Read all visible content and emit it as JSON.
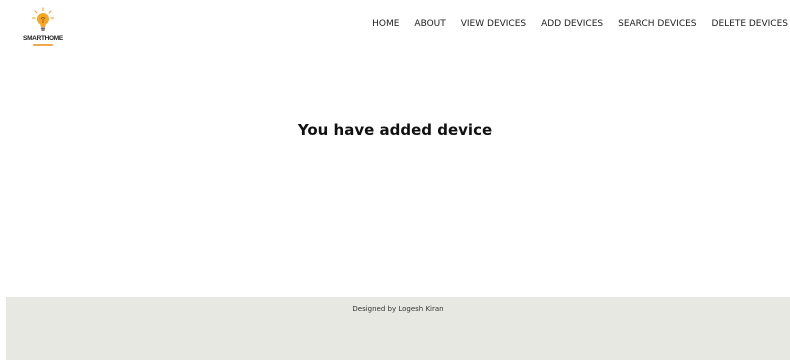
{
  "brand": {
    "logo_text": "SMARTHOME",
    "logo_icon": "lightbulb-icon",
    "accent_color": "#f0a94b"
  },
  "nav": {
    "items": [
      {
        "label": "HOME"
      },
      {
        "label": "ABOUT"
      },
      {
        "label": "VIEW DEVICES"
      },
      {
        "label": "ADD DEVICES"
      },
      {
        "label": "SEARCH DEVICES"
      },
      {
        "label": "DELETE DEVICES"
      }
    ]
  },
  "main": {
    "message": "You have added device"
  },
  "footer": {
    "credit": "Designed by Logesh Kiran",
    "background_color": "#e8e8e3"
  }
}
